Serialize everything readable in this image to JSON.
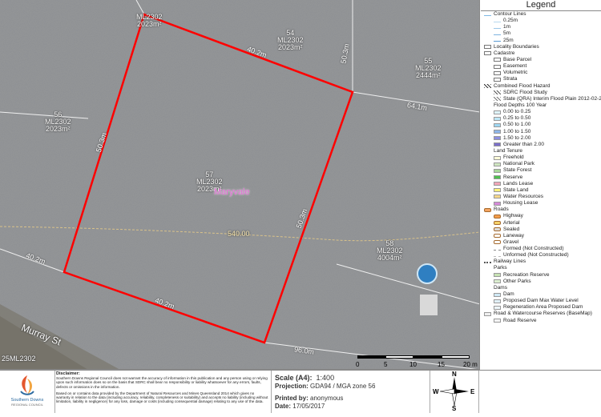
{
  "map": {
    "place_name": "Maryvale",
    "road_name": "Murray St",
    "parcels": [
      {
        "id": "p_top",
        "lot": "",
        "plan": "ML2302",
        "area": "2023m²"
      },
      {
        "id": "p_54",
        "lot": "54",
        "plan": "ML2302",
        "area": "2023m²"
      },
      {
        "id": "p_55",
        "lot": "55",
        "plan": "ML2302",
        "area": "2444m²"
      },
      {
        "id": "p_56",
        "lot": "56",
        "plan": "ML2302",
        "area": "2023m²"
      },
      {
        "id": "p_57",
        "lot": "57",
        "plan": "ML2302",
        "area": "2023m²"
      },
      {
        "id": "p_58",
        "lot": "58",
        "plan": "ML2302",
        "area": "4004m²"
      },
      {
        "id": "p_left",
        "lot": "25",
        "plan": "ML2302",
        "area": ""
      }
    ],
    "dimensions": {
      "top": "40.2m",
      "right": "50.3m",
      "bottom": "40.2m",
      "left": "50.3m",
      "road_left": "40.2m",
      "road_right": "96.0m",
      "side_right": "64.1m",
      "top_right": "50.3m",
      "dashed_line": "540.00"
    }
  },
  "legend": {
    "title": "Legend",
    "items": [
      {
        "label": "Contour Lines",
        "level": "head",
        "swatch": "contour",
        "color": "#7fb9e6"
      },
      {
        "label": "0.25m",
        "level": "sub",
        "swatch": "line",
        "color": "#b8d8ee"
      },
      {
        "label": "1m",
        "level": "sub",
        "swatch": "line",
        "color": "#9cc7e8"
      },
      {
        "label": "5m",
        "level": "sub",
        "swatch": "line",
        "color": "#7eb3e0"
      },
      {
        "label": "25m",
        "level": "sub",
        "swatch": "line",
        "color": "#5a9bd4"
      },
      {
        "label": "Locality Boundaries",
        "level": "head",
        "swatch": "box",
        "color": "#ffffff"
      },
      {
        "label": "Cadastre",
        "level": "head",
        "swatch": "box",
        "color": "#ffffff"
      },
      {
        "label": "Base Parcel",
        "level": "sub",
        "swatch": "box",
        "color": "#ffffff"
      },
      {
        "label": "Easement",
        "level": "sub",
        "swatch": "box",
        "color": "#ffffff"
      },
      {
        "label": "Volumetric",
        "level": "sub",
        "swatch": "box",
        "color": "#ffffff"
      },
      {
        "label": "Strata",
        "level": "sub",
        "swatch": "box",
        "color": "#ffffff"
      },
      {
        "label": "Combined Flood Hazard",
        "level": "head",
        "swatch": "hatch",
        "color": "#333333"
      },
      {
        "label": "SDRC Flood Study",
        "level": "sub",
        "swatch": "hatch",
        "color": "#555555"
      },
      {
        "label": "State (QRA) Interim Flood Plain 2012-02-23",
        "level": "sub",
        "swatch": "hatch",
        "color": "#777777"
      },
      {
        "label": "Flood Depths 100 Year",
        "level": "head",
        "swatch": "none",
        "color": "#ffffff"
      },
      {
        "label": "0.00 to 0.25",
        "level": "sub",
        "swatch": "fill",
        "color": "#dff4fb"
      },
      {
        "label": "0.25 to 0.50",
        "level": "sub",
        "swatch": "fill",
        "color": "#bfe8f7"
      },
      {
        "label": "0.50 to 1.00",
        "level": "sub",
        "swatch": "fill",
        "color": "#9fd7f2"
      },
      {
        "label": "1.00 to 1.50",
        "level": "sub",
        "swatch": "fill",
        "color": "#8fb7ea"
      },
      {
        "label": "1.50 to 2.00",
        "level": "sub",
        "swatch": "fill",
        "color": "#8c8fe0"
      },
      {
        "label": "Greater than 2.00",
        "level": "sub",
        "swatch": "fill",
        "color": "#7a6fc9"
      },
      {
        "label": "Land Tenure",
        "level": "head",
        "swatch": "none",
        "color": "#ffffff"
      },
      {
        "label": "Freehold",
        "level": "sub",
        "swatch": "fill",
        "color": "#fffbd8"
      },
      {
        "label": "National Park",
        "level": "sub",
        "swatch": "fill",
        "color": "#cfe6c1"
      },
      {
        "label": "State Forest",
        "level": "sub",
        "swatch": "fill",
        "color": "#a8d89a"
      },
      {
        "label": "Reserve",
        "level": "sub",
        "swatch": "fill",
        "color": "#4fbf4f"
      },
      {
        "label": "Lands Lease",
        "level": "sub",
        "swatch": "fill",
        "color": "#f1a6b8"
      },
      {
        "label": "State Land",
        "level": "sub",
        "swatch": "fill",
        "color": "#fff27a"
      },
      {
        "label": "Water Resources",
        "level": "sub",
        "swatch": "fill",
        "color": "#f5d78a"
      },
      {
        "label": "Housing Lease",
        "level": "sub",
        "swatch": "fill",
        "color": "#d58ad8"
      },
      {
        "label": "Roads",
        "level": "head",
        "swatch": "road",
        "color": "#f4a460"
      },
      {
        "label": "Highway",
        "level": "sub",
        "swatch": "road",
        "color": "#f39c4a"
      },
      {
        "label": "Arterial",
        "level": "sub",
        "swatch": "road",
        "color": "#f6d36b"
      },
      {
        "label": "Sealed",
        "level": "sub",
        "swatch": "road",
        "color": "#dddddd"
      },
      {
        "label": "Laneway",
        "level": "sub",
        "swatch": "road",
        "color": "#ffffff"
      },
      {
        "label": "Gravel",
        "level": "sub",
        "swatch": "road",
        "color": "#ffffff"
      },
      {
        "label": "Formed (Not Constructed)",
        "level": "sub",
        "swatch": "dash",
        "color": "#888888"
      },
      {
        "label": "Unformed (Not Constructed)",
        "level": "sub",
        "swatch": "dash",
        "color": "#bbbbbb"
      },
      {
        "label": "Railway Lines",
        "level": "head",
        "swatch": "rail",
        "color": "#555555"
      },
      {
        "label": "Parks",
        "level": "head",
        "swatch": "none",
        "color": "#ffffff"
      },
      {
        "label": "Recreation Reserve",
        "level": "sub",
        "swatch": "fill",
        "color": "#c7e3b4"
      },
      {
        "label": "Other Parks",
        "level": "sub",
        "swatch": "fill",
        "color": "#dcefd0"
      },
      {
        "label": "Dams",
        "level": "head",
        "swatch": "none",
        "color": "#ffffff"
      },
      {
        "label": "Dam",
        "level": "sub",
        "swatch": "fill",
        "color": "#cfe8f5"
      },
      {
        "label": "Proposed Dam Max Water Level",
        "level": "sub",
        "swatch": "fill",
        "color": "#e2f1f8"
      },
      {
        "label": "Regeneration Area Proposed Dam",
        "level": "sub",
        "swatch": "fill",
        "color": "#edf6fa"
      },
      {
        "label": "Road & Watercourse Reserves (BaseMap)",
        "level": "head",
        "swatch": "fill",
        "color": "#eeeeee"
      },
      {
        "label": "Road Reserve",
        "level": "sub",
        "swatch": "fill",
        "color": "#f4f4f4"
      }
    ]
  },
  "scalebar": {
    "ticks": [
      "0",
      "5",
      "10",
      "15",
      "20 m"
    ]
  },
  "footer": {
    "logo_line1": "Southern Downs",
    "logo_line2": "REGIONAL COUNCIL",
    "disclaimer_title": "Disclaimer:",
    "disclaimer_p1": "Southern Downs Regional Council does not warrant the accuracy of information in this publication and any person using or relying upon such information does so on the basis that SDRC shall bear no responsibility or liability whatsoever for any errors, faults, defects or omissions in the information.",
    "disclaimer_p2": "Based on or contains data provided by the Department of Natural Resources and Mines Queensland 2014 which gives no warranty in relation to the data (including accuracy, reliability, completeness or suitability) and accepts no liability (including without limitation, liability in negligence) for any loss, damage or costs (including consequential damage) relating to any use of the data.",
    "scale_label": "Scale (A4):",
    "scale_value": "1:400",
    "projection_label": "Projection:",
    "projection_value": "GDA94 / MGA zone 56",
    "printed_label": "Printed by:",
    "printed_value": "anonymous",
    "date_label": "Date:",
    "date_value": "17/05/2017"
  },
  "compass": {
    "n": "N",
    "s": "S",
    "e": "E",
    "w": "W"
  }
}
